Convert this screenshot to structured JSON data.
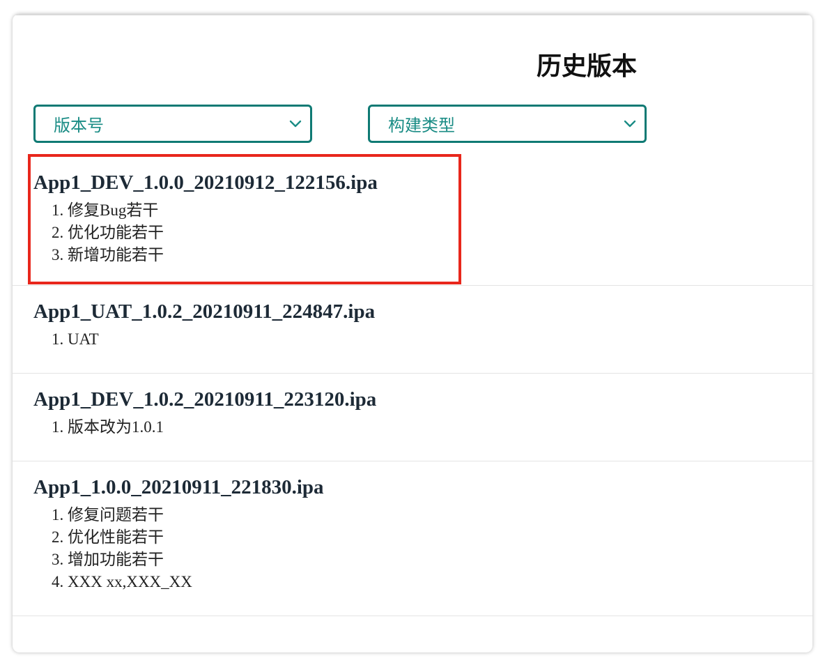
{
  "page": {
    "title": "历史版本"
  },
  "filters": {
    "version": {
      "label": "版本号"
    },
    "build_type": {
      "label": "构建类型"
    }
  },
  "versions": [
    {
      "name": "App1_DEV_1.0.0_20210912_122156.ipa",
      "notes": [
        "1. 修复Bug若干",
        "2. 优化功能若干",
        "3. 新增功能若干"
      ]
    },
    {
      "name": "App1_UAT_1.0.2_20210911_224847.ipa",
      "notes": [
        "1. UAT"
      ]
    },
    {
      "name": "App1_DEV_1.0.2_20210911_223120.ipa",
      "notes": [
        "1. 版本改为1.0.1"
      ]
    },
    {
      "name": "App1_1.0.0_20210911_221830.ipa",
      "notes": [
        "1. 修复问题若干",
        "2. 优化性能若干",
        "3. 增加功能若干",
        "4. XXX xx,XXX_XX"
      ]
    }
  ],
  "colors": {
    "accent": "#0f7a74",
    "accent_text": "#1a8c85",
    "highlight": "#e8271c"
  },
  "icons": {
    "dropdown": "chevron-down-icon"
  }
}
